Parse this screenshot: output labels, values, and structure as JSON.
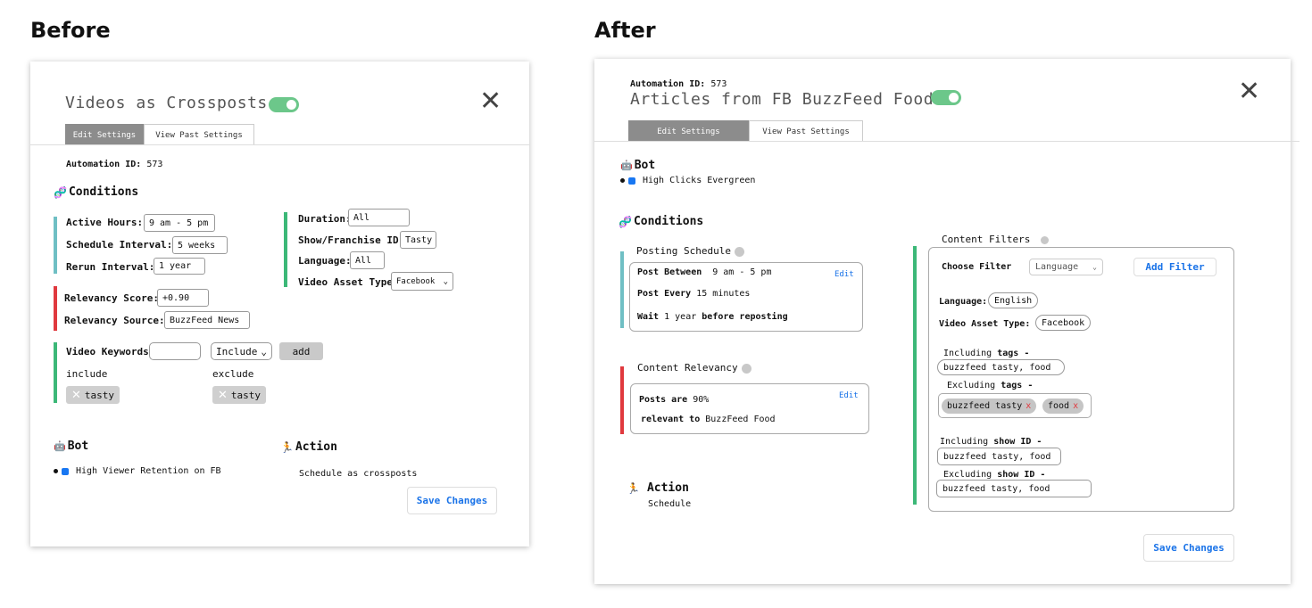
{
  "headings": {
    "before": "Before",
    "after": "After"
  },
  "before": {
    "title": "Videos as Crossposts",
    "tabs": [
      "Edit Settings",
      "View Past Settings"
    ],
    "automation_id_label": "Automation ID:",
    "automation_id": "573",
    "conditions_label": "Conditions",
    "active_hours_label": "Active Hours:",
    "active_hours": "9 am - 5 pm",
    "schedule_interval_label": "Schedule Interval:",
    "schedule_interval": "5 weeks",
    "rerun_interval_label": "Rerun Interval:",
    "rerun_interval": "1 year",
    "duration_label": "Duration:",
    "duration": "All",
    "show_id_label": "Show/Franchise ID:",
    "show_id": "Tasty",
    "language_label": "Language:",
    "language": "All",
    "video_asset_type_label": "Video Asset Type:",
    "video_asset_type": "Facebook",
    "relevancy_score_label": "Relevancy Score:",
    "relevancy_score": "+0.90",
    "relevancy_source_label": "Relevancy Source:",
    "relevancy_source": "BuzzFeed News",
    "video_keywords_label": "Video Keywords:",
    "video_keywords": "",
    "include_select": "Include",
    "add_label": "add",
    "include_label": "include",
    "exclude_label": "exclude",
    "include_chip": "tasty",
    "exclude_chip": "tasty",
    "bot_label": "Bot",
    "bot_value": "High Viewer Retention on FB",
    "action_label": "Action",
    "action_value": "Schedule as crossposts",
    "save_label": "Save Changes"
  },
  "after": {
    "automation_id_label": "Automation ID:",
    "automation_id": "573",
    "title": "Articles from FB BuzzFeed Food",
    "tabs": [
      "Edit Settings",
      "View Past Settings"
    ],
    "bot_label": "Bot",
    "bot_value": "High Clicks Evergreen",
    "conditions_label": "Conditions",
    "posting_schedule_label": "Posting Schedule",
    "post_between_label": "Post Between",
    "post_between": "9 am - 5 pm",
    "post_every_label": "Post Every",
    "post_every": "15 minutes",
    "wait_label": "Wait",
    "wait_value": "1 year",
    "before_reposting": "before reposting",
    "edit_label": "Edit",
    "content_relevancy_label": "Content Relevancy",
    "posts_are_label": "Posts are",
    "posts_are_value": "90%",
    "relevant_to_label": "relevant to",
    "relevant_to_value": "BuzzFeed Food",
    "action_label": "Action",
    "action_value": "Schedule",
    "content_filters_label": "Content Filters",
    "choose_filter_label": "Choose Filter",
    "choose_filter_value": "Language",
    "add_filter_label": "Add Filter",
    "language_label": "Language:",
    "language_value": "English",
    "video_asset_type_label": "Video Asset Type:",
    "video_asset_type_value": "Facebook",
    "including_tags_prefix": "Including",
    "tags_word": "tags",
    "dash": "-",
    "including_tags_value": "buzzfeed tasty, food",
    "excluding_tags_prefix": "Excluding",
    "excluding_tags_pills": [
      "buzzfeed tasty",
      "food"
    ],
    "pill_x": "x",
    "including_show_prefix": "Including",
    "show_id_word": "show ID",
    "including_show_value": "buzzfeed tasty, food",
    "excluding_show_prefix": "Excluding",
    "excluding_show_value": "buzzfeed tasty, food",
    "save_label": "Save Changes"
  },
  "icons": [
    "robot-icon",
    "dna-icon",
    "runner-icon",
    "close-icon",
    "facebook-icon",
    "info-icon"
  ]
}
